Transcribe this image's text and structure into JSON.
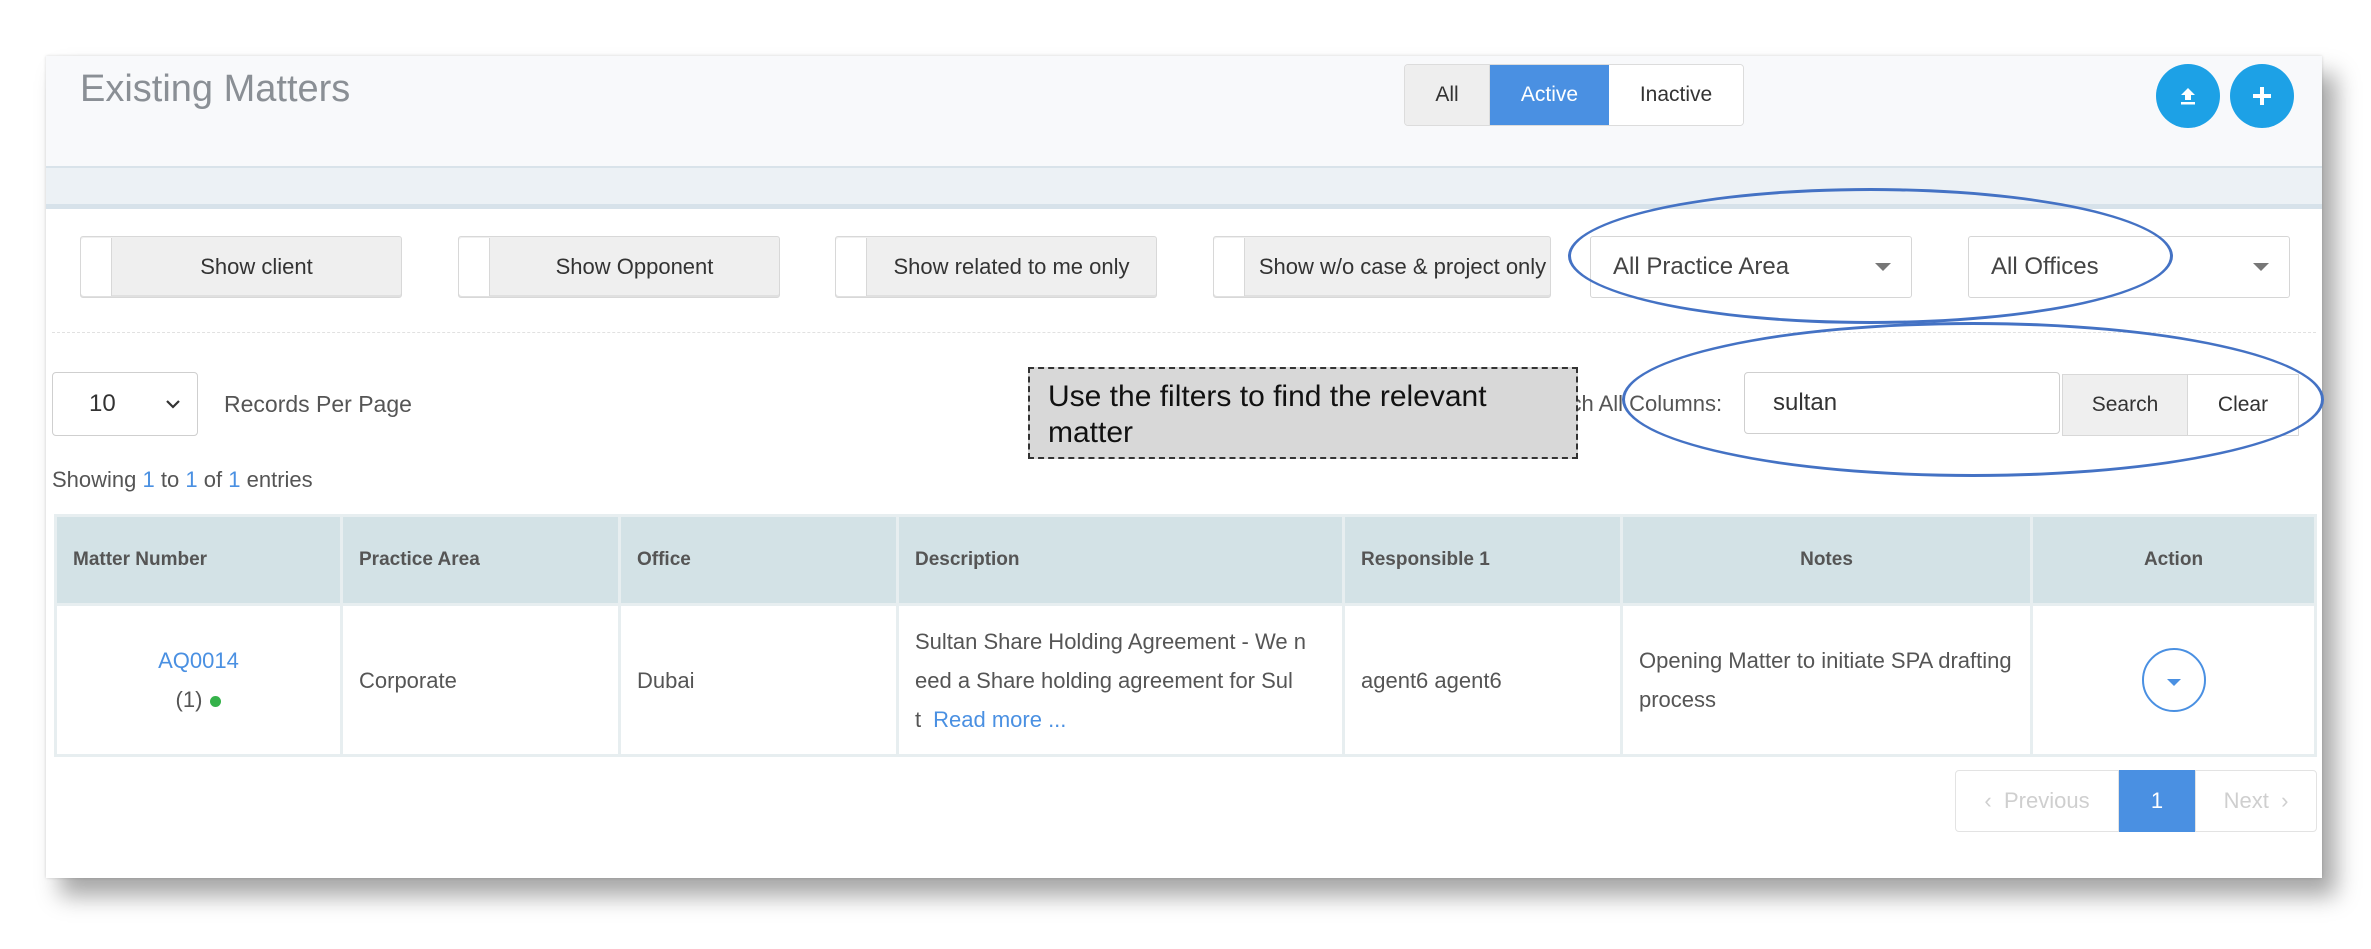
{
  "page": {
    "title": "Existing Matters",
    "status_tabs": [
      "All",
      "Active",
      "Inactive"
    ],
    "active_tab": "Active"
  },
  "header_buttons": {
    "upload_icon": "upload-icon",
    "add_icon": "plus-icon"
  },
  "filters": {
    "show_client": "Show client",
    "show_opponent": "Show Opponent",
    "show_related": "Show related to me only",
    "show_wo_case": "Show w/o case & project only",
    "practice_area": "All Practice Area",
    "offices": "All Offices"
  },
  "records": {
    "per_page_value": "10",
    "per_page_label": "Records Per Page"
  },
  "search": {
    "label": "Search All Columns:",
    "value": "sultan",
    "search_button": "Search",
    "clear_button": "Clear"
  },
  "showing": {
    "prefix": "Showing",
    "from": "1",
    "to_word": "to",
    "to": "1",
    "of_word": "of",
    "total": "1",
    "suffix": "entries"
  },
  "callout": "Use the filters to find the relevant matter",
  "table": {
    "headers": [
      "Matter Number",
      "Practice Area",
      "Office",
      "Description",
      "Responsible 1",
      "Notes",
      "Action"
    ],
    "rows": [
      {
        "matter_number": "AQ0014",
        "matter_count": "(1)",
        "practice_area": "Corporate",
        "office": "Dubai",
        "description": "Sultan Share Holding Agreement - We n eed a Share holding agreement for Sul t",
        "read_more": "Read more ...",
        "responsible": "agent6 agent6",
        "notes": "Opening Matter to initiate SPA drafting process"
      }
    ]
  },
  "pagination": {
    "previous": "Previous",
    "current": "1",
    "next": "Next"
  },
  "colors": {
    "accent": "#4a90e2",
    "fab": "#1da1e6",
    "annotation": "#4472c4"
  }
}
